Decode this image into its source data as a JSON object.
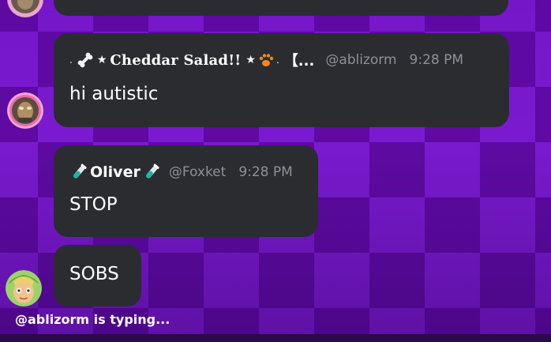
{
  "messages": [
    {
      "display_name": "Cheddar Salad!!",
      "name_prefix": ". ★",
      "name_suffix": "★",
      "name_tail": ". 【...",
      "username": "@ablizorm",
      "time": "9:28 PM",
      "text": "hi autistic"
    },
    {
      "display_name": "Oliver",
      "username": "@Foxket",
      "time": "9:28 PM",
      "text": "STOP"
    },
    {
      "text": "SOBS"
    }
  ],
  "typing_indicator": "@ablizorm is typing...",
  "icons": [
    "bone-icon",
    "paw-icon",
    "test-tube-icon",
    "avatar"
  ],
  "colors": {
    "bubble": "#2b2c30",
    "muted": "#8e9096",
    "background_purple": "#6a10b8"
  }
}
